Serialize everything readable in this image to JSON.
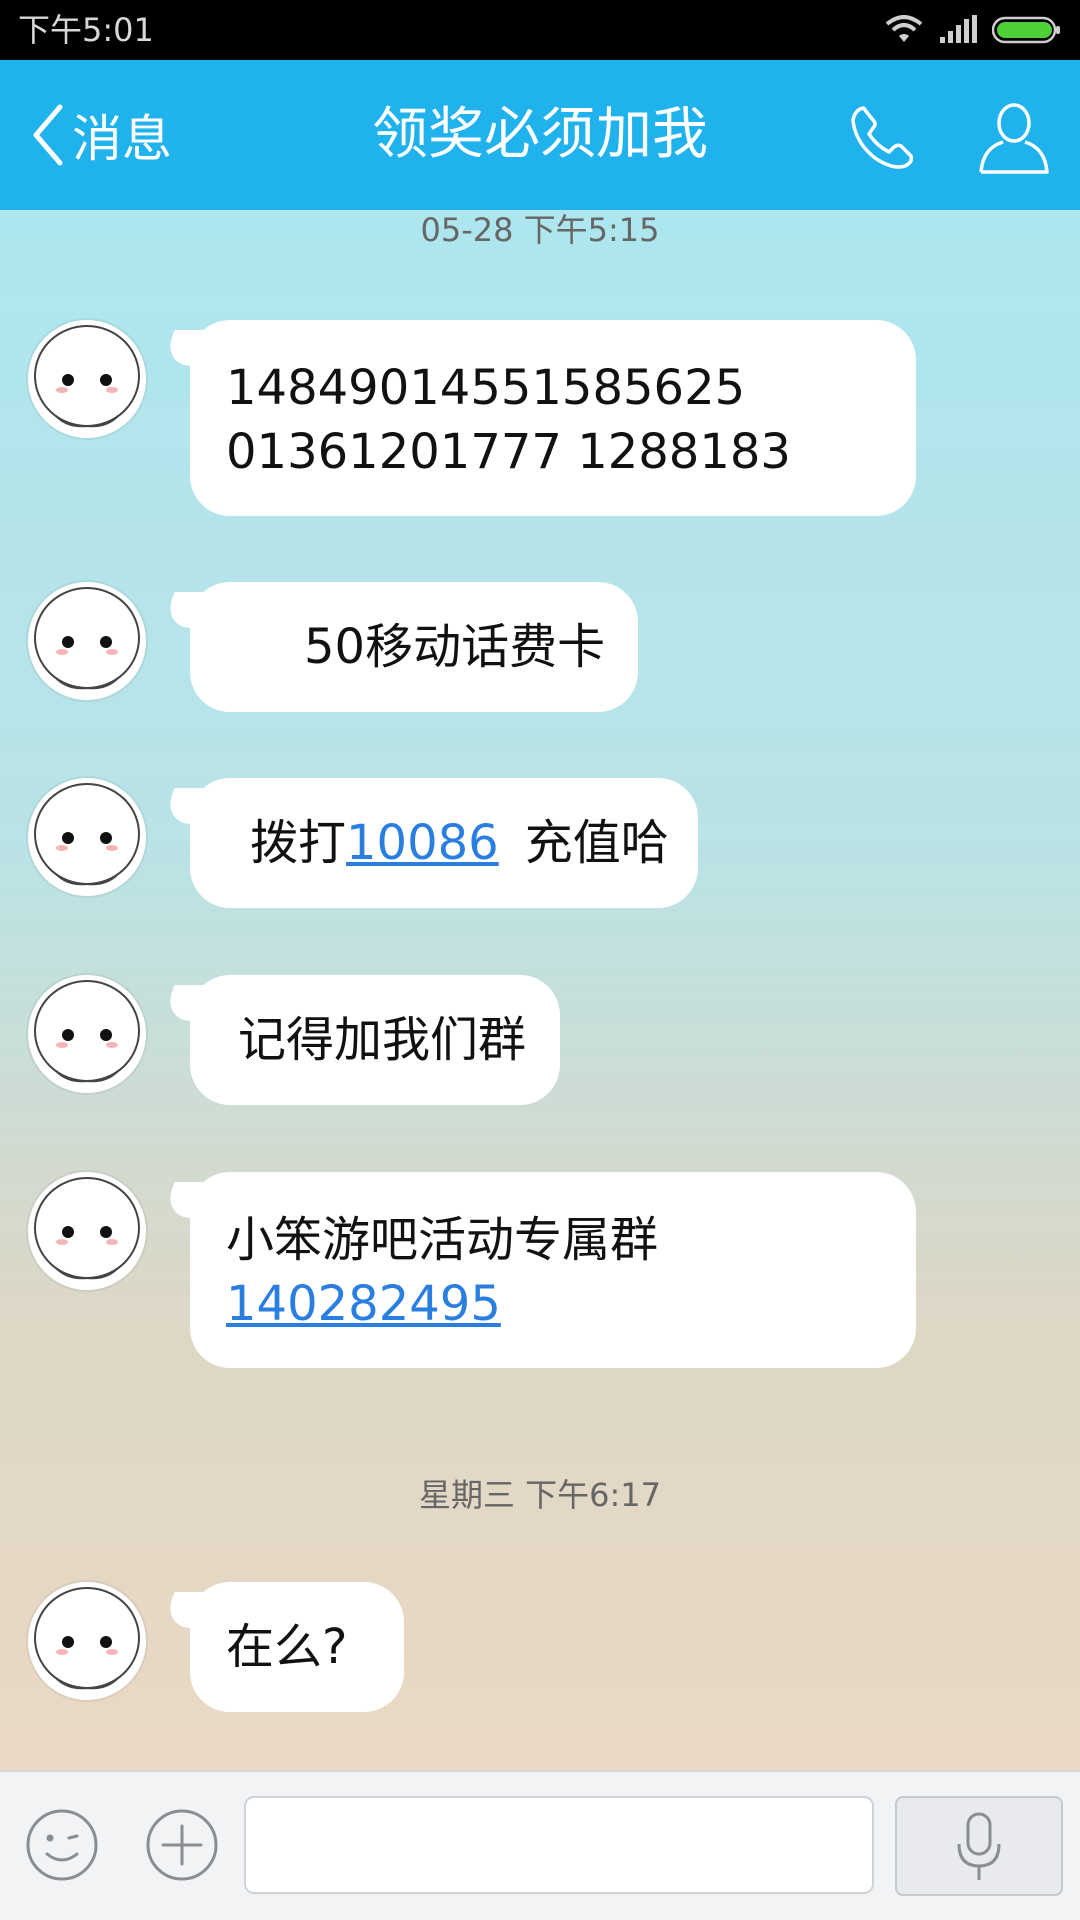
{
  "status_bar": {
    "time": "下午5:01"
  },
  "nav": {
    "back_label": "消息",
    "title": "领奖必须加我"
  },
  "chat": {
    "timestamp_1": "05-28 下午5:15",
    "timestamp_2": "星期三 下午6:17",
    "messages": [
      {
        "line1": "14849014551585625",
        "line2": "01361201777 1288183"
      },
      {
        "text": "50移动话费卡"
      },
      {
        "prefix": "拨打",
        "link": "10086",
        "suffix": "充值哈"
      },
      {
        "text": "记得加我们群"
      },
      {
        "line1": "小笨游吧活动专属群",
        "link": "140282495"
      },
      {
        "text": "在么?"
      }
    ]
  },
  "input_bar": {
    "input_value": ""
  },
  "colors": {
    "nav_bg": "#1fb2ec",
    "link": "#2a7ee0",
    "battery": "#4cd137"
  },
  "icons": {
    "back": "chevron-left-icon",
    "call": "phone-icon",
    "profile": "person-icon",
    "emoji": "smiley-icon",
    "plus": "plus-circle-icon",
    "voice": "microphone-icon"
  }
}
